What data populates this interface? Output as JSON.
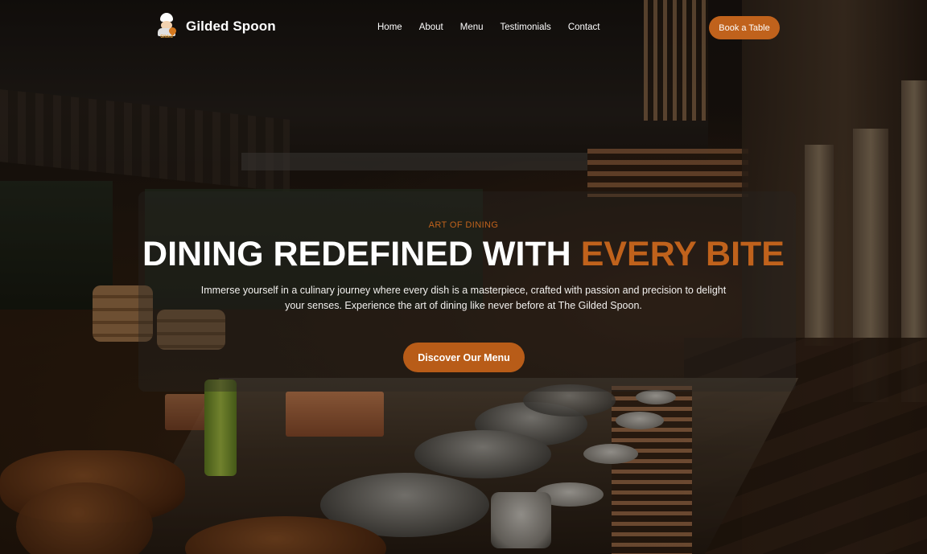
{
  "brand": {
    "name": "Gilded Spoon",
    "logo_label": "Gilded"
  },
  "nav": {
    "links": [
      "Home",
      "About",
      "Menu",
      "Testimonials",
      "Contact"
    ],
    "cta_label": "Book a Table"
  },
  "hero": {
    "eyebrow": "ART OF DINING",
    "headline_main": "DINING REDEFINED WITH ",
    "headline_accent": "EVERY BITE",
    "description": "Immerse yourself in a culinary journey where every dish is a masterpiece, crafted with passion and precision to delight your senses. Experience the art of dining like never before at The Gilded Spoon.",
    "button_label": "Discover Our Menu",
    "background": "restaurant-kitchen-photo"
  },
  "colors": {
    "accent": "#c0621c",
    "button": "#b85c18",
    "text": "#ffffff"
  },
  "icons": [
    "chef-logo-icon"
  ]
}
